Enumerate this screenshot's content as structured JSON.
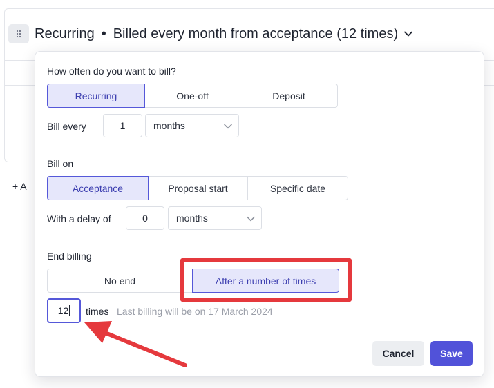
{
  "header": {
    "title": "Recurring",
    "separator": "•",
    "summary": "Billed every month from acceptance (12 times)"
  },
  "background": {
    "add_label": "+ A"
  },
  "popover": {
    "frequency": {
      "label": "How often do you want to bill?",
      "options": [
        "Recurring",
        "One-off",
        "Deposit"
      ],
      "selected": "Recurring"
    },
    "bill_every": {
      "label": "Bill every",
      "value": "1",
      "unit": "months"
    },
    "bill_on": {
      "label": "Bill on",
      "options": [
        "Acceptance",
        "Proposal start",
        "Specific date"
      ],
      "selected": "Acceptance"
    },
    "delay": {
      "label": "With a delay of",
      "value": "0",
      "unit": "months"
    },
    "end_billing": {
      "label": "End billing",
      "options": [
        "No end",
        "After a number of times"
      ],
      "selected": "After a number of times"
    },
    "times": {
      "value": "12",
      "label": "times",
      "note": "Last billing will be on 17 March 2024"
    },
    "actions": {
      "cancel": "Cancel",
      "save": "Save"
    }
  },
  "colors": {
    "accent": "#5152d9",
    "annotation": "#e5393d"
  }
}
